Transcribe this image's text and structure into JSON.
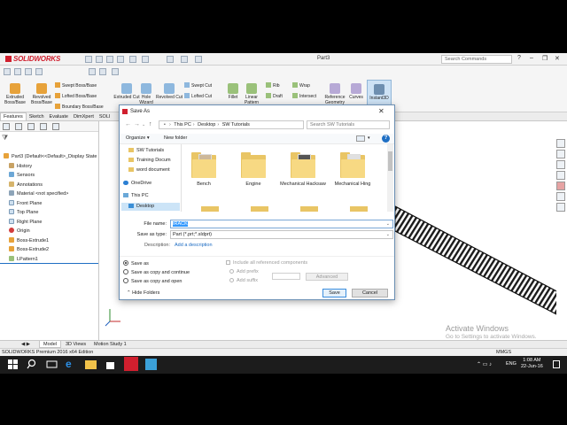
{
  "app": {
    "logo": "SOLIDWORKS",
    "document_title": "Part3",
    "search_placeholder": "Search Commands"
  },
  "ribbon": {
    "buttons": [
      {
        "label": "Extruded Boss/Base",
        "icon": "extrude-icon"
      },
      {
        "label": "Revolved Boss/Base",
        "icon": "revolve-icon"
      },
      {
        "label": "Extruded Cut",
        "icon": "extruded-cut-icon"
      },
      {
        "label": "Hole Wizard",
        "icon": "hole-wizard-icon"
      },
      {
        "label": "Revolved Cut",
        "icon": "revolved-cut-icon"
      },
      {
        "label": "Fillet",
        "icon": "fillet-icon"
      },
      {
        "label": "Linear Pattern",
        "icon": "linear-pattern-icon"
      },
      {
        "label": "Reference Geometry",
        "icon": "reference-geometry-icon"
      },
      {
        "label": "Curves",
        "icon": "curves-icon"
      },
      {
        "label": "Instant3D",
        "icon": "instant3d-icon"
      }
    ],
    "small_buttons": [
      "Swept Boss/Base",
      "Lofted Boss/Base",
      "Boundary Boss/Base",
      "Swept Cut",
      "Lofted Cut",
      "Rib",
      "Draft",
      "Wrap",
      "Intersect"
    ],
    "colors": {
      "accent": "#d01f2e",
      "feature": "#e7a23a"
    }
  },
  "command_tabs": [
    "Features",
    "Sketch",
    "Evaluate",
    "DimXpert",
    "SOLI"
  ],
  "feature_tree": {
    "root": "Part3  (Default<<Default>_Display State",
    "items": [
      {
        "label": "History",
        "icon": "history-icon"
      },
      {
        "label": "Sensors",
        "icon": "sensors-icon"
      },
      {
        "label": "Annotations",
        "icon": "annotations-icon"
      },
      {
        "label": "Material <not specified>",
        "icon": "material-icon"
      },
      {
        "label": "Front Plane",
        "icon": "plane-icon"
      },
      {
        "label": "Top Plane",
        "icon": "plane-icon"
      },
      {
        "label": "Right Plane",
        "icon": "plane-icon"
      },
      {
        "label": "Origin",
        "icon": "origin-icon"
      },
      {
        "label": "Boss-Extrude1",
        "icon": "extrude-icon"
      },
      {
        "label": "Boss-Extrude2",
        "icon": "extrude-icon"
      },
      {
        "label": "LPattern1",
        "icon": "linear-pattern-icon"
      }
    ]
  },
  "watermark": {
    "line1": "Activate Windows",
    "line2": "Go to Settings to activate Windows."
  },
  "bottom_tabs": [
    "Model",
    "3D Views",
    "Motion Study 1"
  ],
  "status": {
    "left": "SOLIDWORKS Premium 2016 x64 Edition",
    "units": "MMGS"
  },
  "taskbar": {
    "language": "ENG",
    "time": "1:08 AM",
    "date": "22-Jun-16"
  },
  "dialog": {
    "title": "Save As",
    "breadcrumb": [
      "This PC",
      "Desktop",
      "SW Tutorials"
    ],
    "search_placeholder": "Search SW Tutorials",
    "organize": "Organize",
    "new_folder": "New folder",
    "help": "?",
    "nav": [
      {
        "label": "SW Tutorials",
        "icon": "folder-icon"
      },
      {
        "label": "Training Docum",
        "icon": "folder-icon"
      },
      {
        "label": "word document",
        "icon": "folder-icon"
      },
      {
        "label": "OneDrive",
        "icon": "onedrive-icon"
      },
      {
        "label": "This PC",
        "icon": "this-pc-icon"
      },
      {
        "label": "Desktop",
        "icon": "desktop-icon"
      }
    ],
    "folders": [
      "Bench",
      "Engine",
      "Mechanical Hacksaw",
      "Mechanical Hing"
    ],
    "file_name_label": "File name:",
    "file_name": "tRACK",
    "save_type_label": "Save as type:",
    "save_type": "Part (*.prt;*.sldprt)",
    "description_label": "Description:",
    "description_link": "Add a description",
    "options": {
      "save_as": "Save as",
      "save_as_copy_continue": "Save as copy and continue",
      "save_as_copy_open": "Save as copy and open",
      "include_refs": "Include all referenced components",
      "add_prefix": "Add prefix",
      "add_suffix": "Add suffix",
      "advanced": "Advanced"
    },
    "hide_folders": "Hide Folders",
    "save": "Save",
    "cancel": "Cancel"
  }
}
